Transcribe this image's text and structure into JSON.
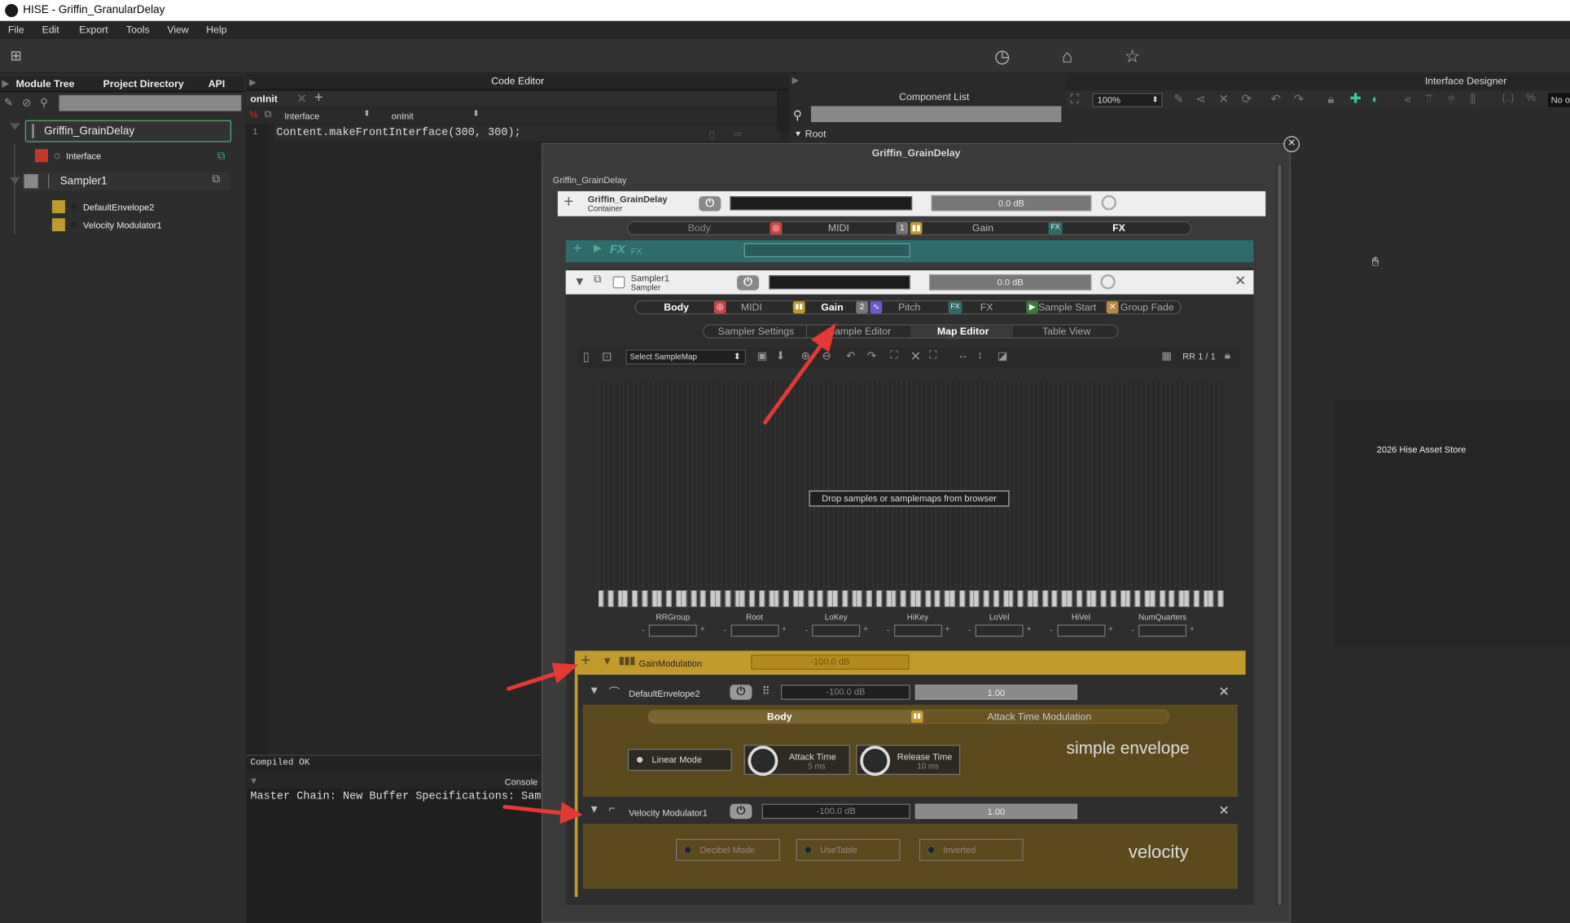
{
  "window": {
    "title": "HISE - Griffin_GranularDelay"
  },
  "menu": [
    "File",
    "Edit",
    "Export",
    "Tools",
    "View",
    "Help"
  ],
  "left_panel": {
    "tabs": [
      "Module Tree",
      "Project Directory",
      "API"
    ],
    "tree": {
      "root": "Griffin_GrainDelay",
      "interface": "Interface",
      "sampler": "Sampler1",
      "modulators": [
        "DefaultEnvelope2",
        "Velocity Modulator1"
      ]
    }
  },
  "code_editor": {
    "header": "Code Editor",
    "tab": "onInit",
    "selector_left": "Interface",
    "selector_right": "onInit",
    "line_number": "1",
    "code": "Content.makeFrontInterface(300, 300);",
    "status": "Compiled OK",
    "console_header": "Console",
    "console_text": "Master Chain: New Buffer Specifications: Samp"
  },
  "component_list": {
    "header": "Component List",
    "root": "Root"
  },
  "interface_designer": {
    "header": "Interface Designer",
    "zoom": "100%",
    "right_text": "No o",
    "asset_store": "2026 Hise Asset Store"
  },
  "popup": {
    "title": "Griffin_GrainDelay",
    "breadcrumb": "Griffin_GrainDelay",
    "container": {
      "name": "Griffin_GrainDelay",
      "type": "Container",
      "gain": "0.0 dB",
      "tabs": [
        "Body",
        "MIDI",
        "Gain",
        "FX"
      ],
      "tab_badge": "1"
    },
    "fx": {
      "label": "FX"
    },
    "sampler": {
      "name": "Sampler1",
      "type": "Sampler",
      "gain": "0.0 dB",
      "tabs": [
        "Body",
        "MIDI",
        "Gain",
        "Pitch",
        "FX",
        "Sample Start",
        "Group Fade"
      ],
      "tab_badge": "2",
      "subtabs": [
        "Sampler Settings",
        "Sample Editor",
        "Map Editor",
        "Table View"
      ],
      "select_samplemap": "Select SampleMap",
      "rr": "RR 1 / 1",
      "drop_text": "Drop samples or samplemaps from browser",
      "fields": [
        "RRGroup",
        "Root",
        "LoKey",
        "HiKey",
        "LoVel",
        "HiVel",
        "NumQuarters"
      ]
    },
    "gain_mod": {
      "label": "GainModulation",
      "value": "-100.0 dB"
    },
    "envelope": {
      "name": "DefaultEnvelope2",
      "db": "-100.0 dB",
      "value": "1.00",
      "tabs": [
        "Body",
        "Attack Time Modulation"
      ],
      "linear_mode": "Linear Mode",
      "attack_label": "Attack Time",
      "attack_value": "5 ms",
      "release_label": "Release Time",
      "release_value": "10 ms",
      "title": "simple envelope"
    },
    "velocity": {
      "name": "Velocity Modulator1",
      "db": "-100.0 dB",
      "value": "1.00",
      "buttons": [
        "Decibel Mode",
        "UseTable",
        "Inverted"
      ],
      "title": "velocity"
    }
  },
  "colors": {
    "accent_gold": "#c19a2e",
    "fx_teal": "#2f6b6b",
    "arrow_red": "#e53935"
  }
}
